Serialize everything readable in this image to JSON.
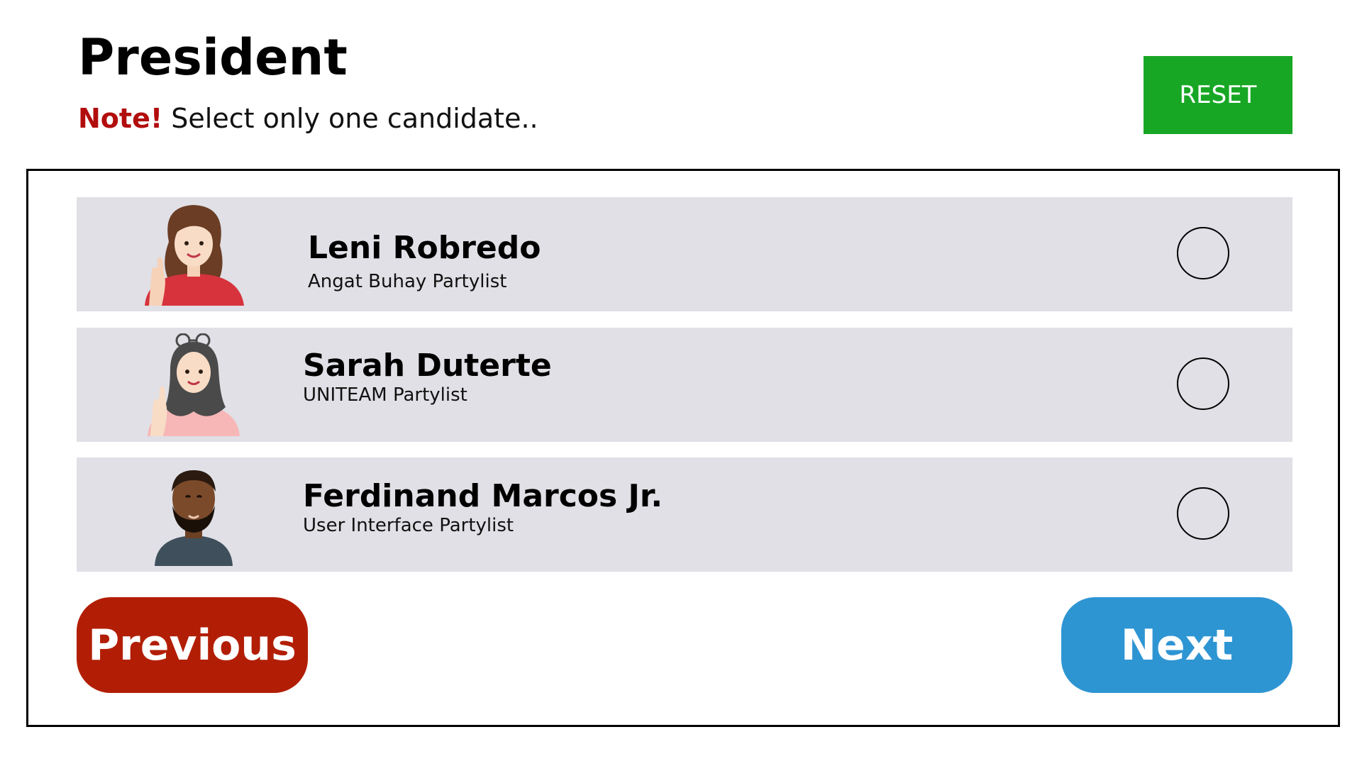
{
  "header": {
    "title": "President",
    "note_label": "Note!",
    "note_text": " Select only one candidate..",
    "reset_label": "RESET"
  },
  "candidates": [
    {
      "name": "Leni Robredo",
      "party": "Angat Buhay Partylist",
      "avatar": "woman-avatar-icon",
      "selected": false
    },
    {
      "name": "Sarah Duterte",
      "party": "UNITEAM Partylist",
      "avatar": "hijab-woman-avatar-icon",
      "selected": false
    },
    {
      "name": "Ferdinand Marcos Jr.",
      "party": "User Interface Partylist",
      "avatar": "bearded-man-avatar-icon",
      "selected": false
    }
  ],
  "navigation": {
    "previous_label": "Previous",
    "next_label": "Next"
  },
  "colors": {
    "reset": "#18a725",
    "note": "#b20d0d",
    "previous": "#b21e05",
    "next": "#2e95d3",
    "row_background": "#e0e0e6"
  }
}
